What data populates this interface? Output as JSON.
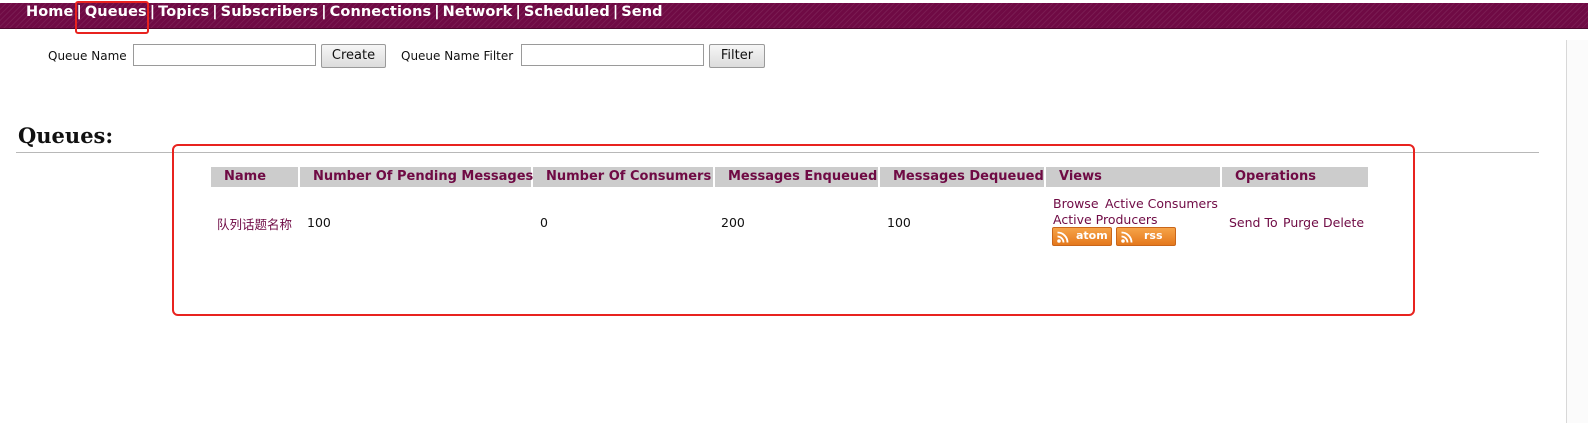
{
  "nav": {
    "items": [
      "Home",
      "Queues",
      "Topics",
      "Subscribers",
      "Connections",
      "Network",
      "Scheduled",
      "Send"
    ],
    "separator": "|",
    "active": "Queues",
    "bg_color": "#6f0a44"
  },
  "form": {
    "queue_name_label": "Queue Name",
    "queue_name_value": "",
    "create_label": "Create",
    "filter_label": "Queue Name Filter",
    "filter_value": "",
    "filter_button": "Filter"
  },
  "page": {
    "heading": "Queues:"
  },
  "table": {
    "headers": [
      "Name",
      "Number Of Pending Messages",
      "Number Of Consumers",
      "Messages Enqueued",
      "Messages Dequeued",
      "Views",
      "Operations"
    ],
    "rows": [
      {
        "name": "队列话题名称",
        "pending": "100",
        "consumers": "0",
        "enqueued": "200",
        "dequeued": "100",
        "views": {
          "browse": "Browse",
          "active_consumers": "Active Consumers",
          "active_producers": "Active Producers",
          "atom": "atom",
          "rss": "rss"
        },
        "operations": {
          "send_to": "Send To",
          "purge": "Purge",
          "delete": "Delete"
        }
      }
    ]
  },
  "colors": {
    "link": "#6f0a44",
    "header_bg": "#cccccc",
    "highlight": "#e8231f",
    "feed": "#ef8b2c"
  }
}
